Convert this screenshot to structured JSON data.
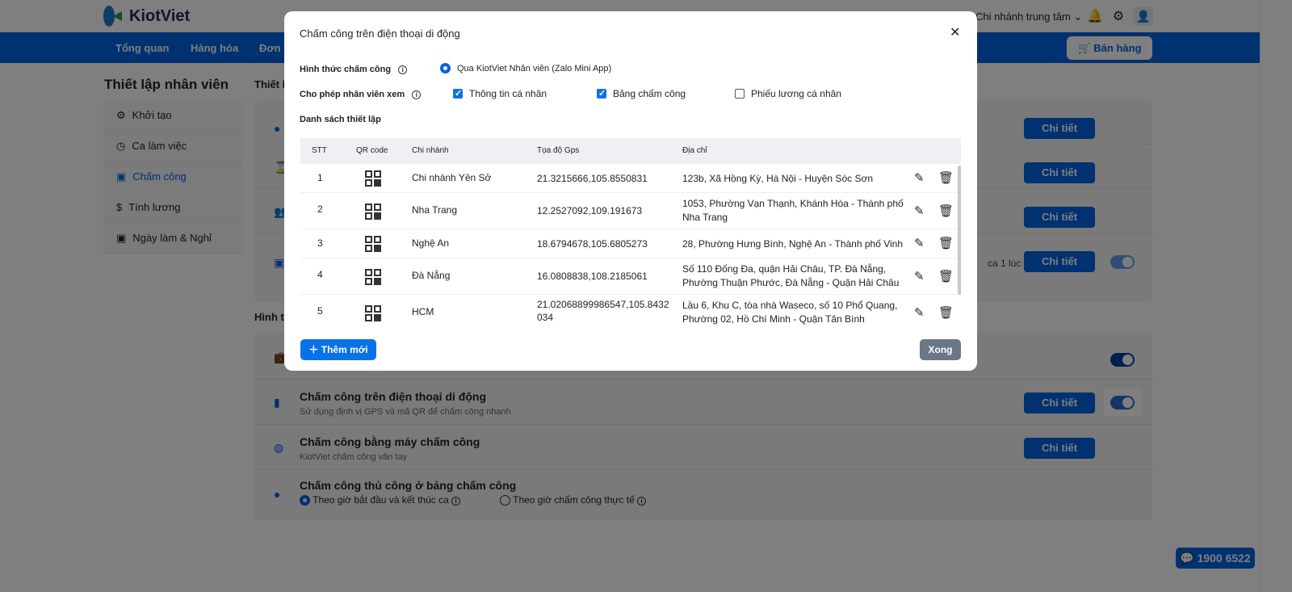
{
  "header": {
    "brand": "KiotViet",
    "branch": "Chi nhánh trung tâm",
    "sell_button": "Bán hàng"
  },
  "nav": [
    "Tổng quan",
    "Hàng hóa",
    "Đơn h"
  ],
  "sidebar": {
    "title": "Thiết lập nhân viên",
    "items": [
      {
        "label": "Khởi tạo",
        "icon": "gear-icon"
      },
      {
        "label": "Ca làm việc",
        "icon": "clock-icon"
      },
      {
        "label": "Chấm công",
        "icon": "calendar-edit-icon",
        "active": true
      },
      {
        "label": "Tính lương",
        "icon": "dollar-icon"
      },
      {
        "label": "Ngày làm & Nghỉ",
        "icon": "calendar-star-icon"
      }
    ]
  },
  "main": {
    "section1_title": "Thiết lậ",
    "partial_text": "ca 1 lúc",
    "section2_title": "Hình th",
    "detail_label": "Chi tiết",
    "methods": [
      {
        "title": "Chấm công trên điện thoại di động",
        "subtitle": "Sử dụng định vị GPS và mã QR để chấm công nhanh"
      },
      {
        "title": "Chấm công bằng máy chấm công",
        "subtitle": "KiotViet chấm công vân tay"
      },
      {
        "title": "Chấm công thủ công ở bảng chấm công",
        "option1": "Theo giờ bắt đầu và kết thúc ca",
        "option2": "Theo giờ chấm công thực tế"
      }
    ]
  },
  "hotline": "1900 6522",
  "modal": {
    "title": "Chấm công trên điện thoại di động",
    "method_label": "Hình thức chấm công",
    "method_value": "Qua KiotViet Nhân viên (Zalo Mini App)",
    "allow_label": "Cho phép nhân viên xem",
    "allow_options": [
      {
        "label": "Thông tin cá nhân",
        "checked": true
      },
      {
        "label": "Bảng chấm công",
        "checked": true
      },
      {
        "label": "Phiếu lương cá nhân",
        "checked": false
      }
    ],
    "list_label": "Danh sách thiết lập",
    "columns": [
      "STT",
      "QR code",
      "Chi nhánh",
      "Tọa độ Gps",
      "Địa chỉ"
    ],
    "rows": [
      {
        "stt": "1",
        "branch": "Chi nhánh Yên Sở",
        "gps": "21.3215666,105.8550831",
        "address": "123b, Xã Hồng Kỳ, Hà Nội - Huyện Sóc Sơn"
      },
      {
        "stt": "2",
        "branch": "Nha Trang",
        "gps": "12.2527092,109.191673",
        "address": "1053, Phường Vạn Thạnh, Khánh Hòa - Thành phố Nha Trang"
      },
      {
        "stt": "3",
        "branch": "Nghệ An",
        "gps": "18.6794678,105.6805273",
        "address": "28, Phường Hưng Bình, Nghệ An - Thành phố Vinh"
      },
      {
        "stt": "4",
        "branch": "Đà Nẵng",
        "gps": "16.0808838,108.2185061",
        "address": "Số 110 Đống Đa, quận Hải Châu, TP. Đà Nẵng, Phường Thuận Phước, Đà Nẵng - Quận Hải Châu"
      },
      {
        "stt": "5",
        "branch": "HCM",
        "gps": "21.02068899986547,105.8432034",
        "address": "Lầu 6, Khu C, tòa nhà Waseco, số 10 Phổ Quang, Phường 02, Hồ Chí Minh - Quận Tân Bình"
      }
    ],
    "add_button": "Thêm mới",
    "done_button": "Xong"
  },
  "colors": {
    "primary": "#0062e0",
    "modal_primary": "#0a72e8",
    "done": "#6b7686"
  }
}
